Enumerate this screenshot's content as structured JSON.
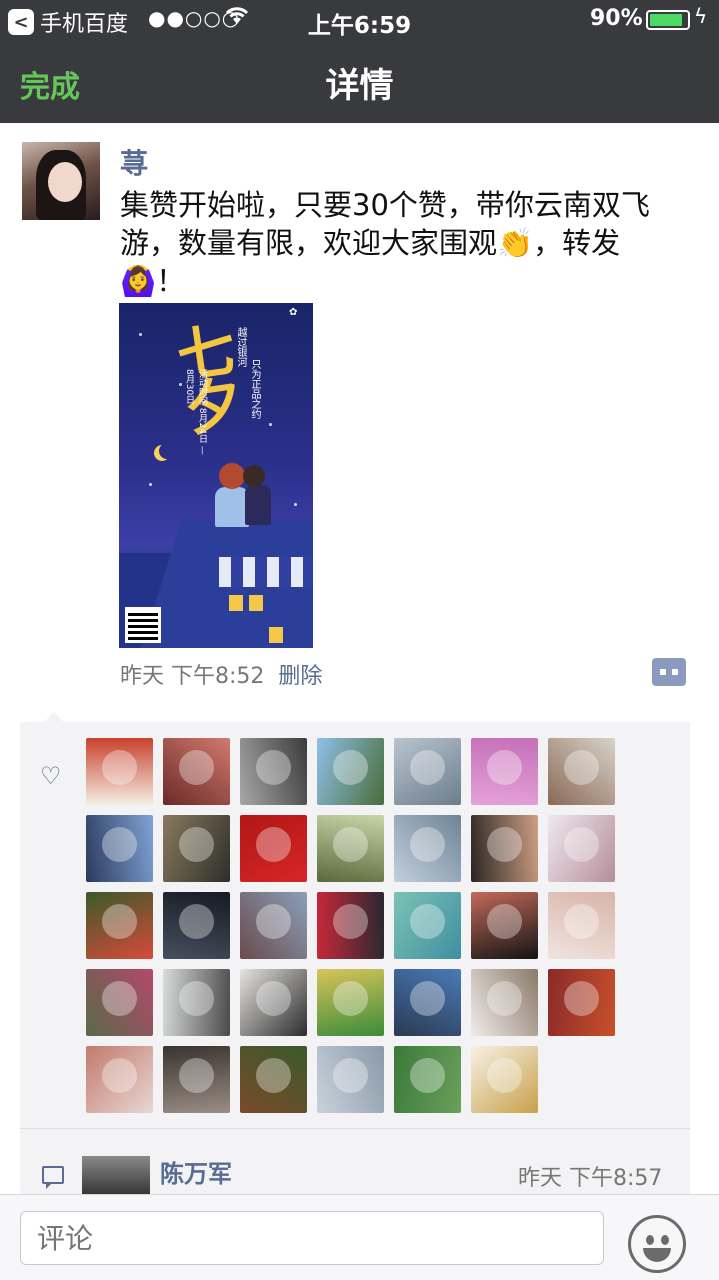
{
  "status_bar": {
    "back_app": "手机百度",
    "signal": "●●○○○",
    "time": "上午6:59",
    "battery": "90%",
    "battery_level": 0.9
  },
  "nav": {
    "done_label": "完成",
    "title": "详情"
  },
  "post": {
    "author": "荨",
    "text": "集赞开始啦，只要30个赞，带你云南双飞游，数量有限，欢迎大家围观👏，转发🙆‍♀️！",
    "poster": {
      "headline": "七夕",
      "subtitle": "越过银河",
      "tagline": "只为正品之约",
      "dates": "活动时间 8月24日 — 8月30日"
    },
    "time": "昨天 下午8:52",
    "delete_label": "删除"
  },
  "likes": {
    "avatars": [
      {
        "c1": "#f3efe4",
        "c2": "#c9412d"
      },
      {
        "c1": "#6a2a28",
        "c2": "#d27a6e"
      },
      {
        "c1": "#a8a8a8",
        "c2": "#3b3b3b"
      },
      {
        "c1": "#8ec0e8",
        "c2": "#4a6d3a"
      },
      {
        "c1": "#b9c4cf",
        "c2": "#6c7d8c"
      },
      {
        "c1": "#c56fb8",
        "c2": "#e4a2d8"
      },
      {
        "c1": "#d8d2c9",
        "c2": "#8a6a56"
      },
      {
        "c1": "#7fa4d6",
        "c2": "#2c3a5c"
      },
      {
        "c1": "#2d2f2a",
        "c2": "#8a7a5e"
      },
      {
        "c1": "#d62626",
        "c2": "#b11616"
      },
      {
        "c1": "#5a6a3a",
        "c2": "#c9d6a8"
      },
      {
        "c1": "#c3cfdc",
        "c2": "#6c8496"
      },
      {
        "c1": "#2b2622",
        "c2": "#cf9f84"
      },
      {
        "c1": "#efe8ee",
        "c2": "#b58e9a"
      },
      {
        "c1": "#3a5a2a",
        "c2": "#d84a3a"
      },
      {
        "c1": "#151a22",
        "c2": "#46505e"
      },
      {
        "c1": "#8aa0b8",
        "c2": "#6a4a4e"
      },
      {
        "c1": "#2a2830",
        "c2": "#c8283a"
      },
      {
        "c1": "#3f8fa0",
        "c2": "#7cc2b6"
      },
      {
        "c1": "#141414",
        "c2": "#c26a5a"
      },
      {
        "c1": "#f0e4e0",
        "c2": "#d8b4a8"
      },
      {
        "c1": "#5a6a4a",
        "c2": "#b4486a"
      },
      {
        "c1": "#d8dcda",
        "c2": "#4a4a4a"
      },
      {
        "c1": "#e6e4e2",
        "c2": "#2c2c2c"
      },
      {
        "c1": "#d8c45a",
        "c2": "#3a8c3a"
      },
      {
        "c1": "#4a7ab8",
        "c2": "#2a3a52"
      },
      {
        "c1": "#8a7a6a",
        "c2": "#f0ece8"
      },
      {
        "c1": "#c8502a",
        "c2": "#8a2a2a"
      },
      {
        "c1": "#e8d8d2",
        "c2": "#c27a6e"
      },
      {
        "c1": "#9a8e84",
        "c2": "#3a342e"
      },
      {
        "c1": "#7a4a2a",
        "c2": "#3a5a2a"
      },
      {
        "c1": "#c8d2dc",
        "c2": "#8a9aa8"
      },
      {
        "c1": "#3a7a3a",
        "c2": "#6aa05a"
      },
      {
        "c1": "#f6f2e6",
        "c2": "#c8a04a"
      }
    ]
  },
  "comment": {
    "name": "陈万军",
    "time": "昨天 下午8:57"
  },
  "input": {
    "placeholder": "评论"
  },
  "icons": {
    "heart": "heart-icon",
    "comment": "comment-icon",
    "emoji": "emoji-icon",
    "more": "more-icon",
    "wifi": "wifi-icon",
    "bolt": "charging-icon"
  },
  "colors": {
    "nav_bg": "#393a3e",
    "done": "#65c75a",
    "link": "#576b95",
    "likes_bg": "#f3f3f5"
  }
}
